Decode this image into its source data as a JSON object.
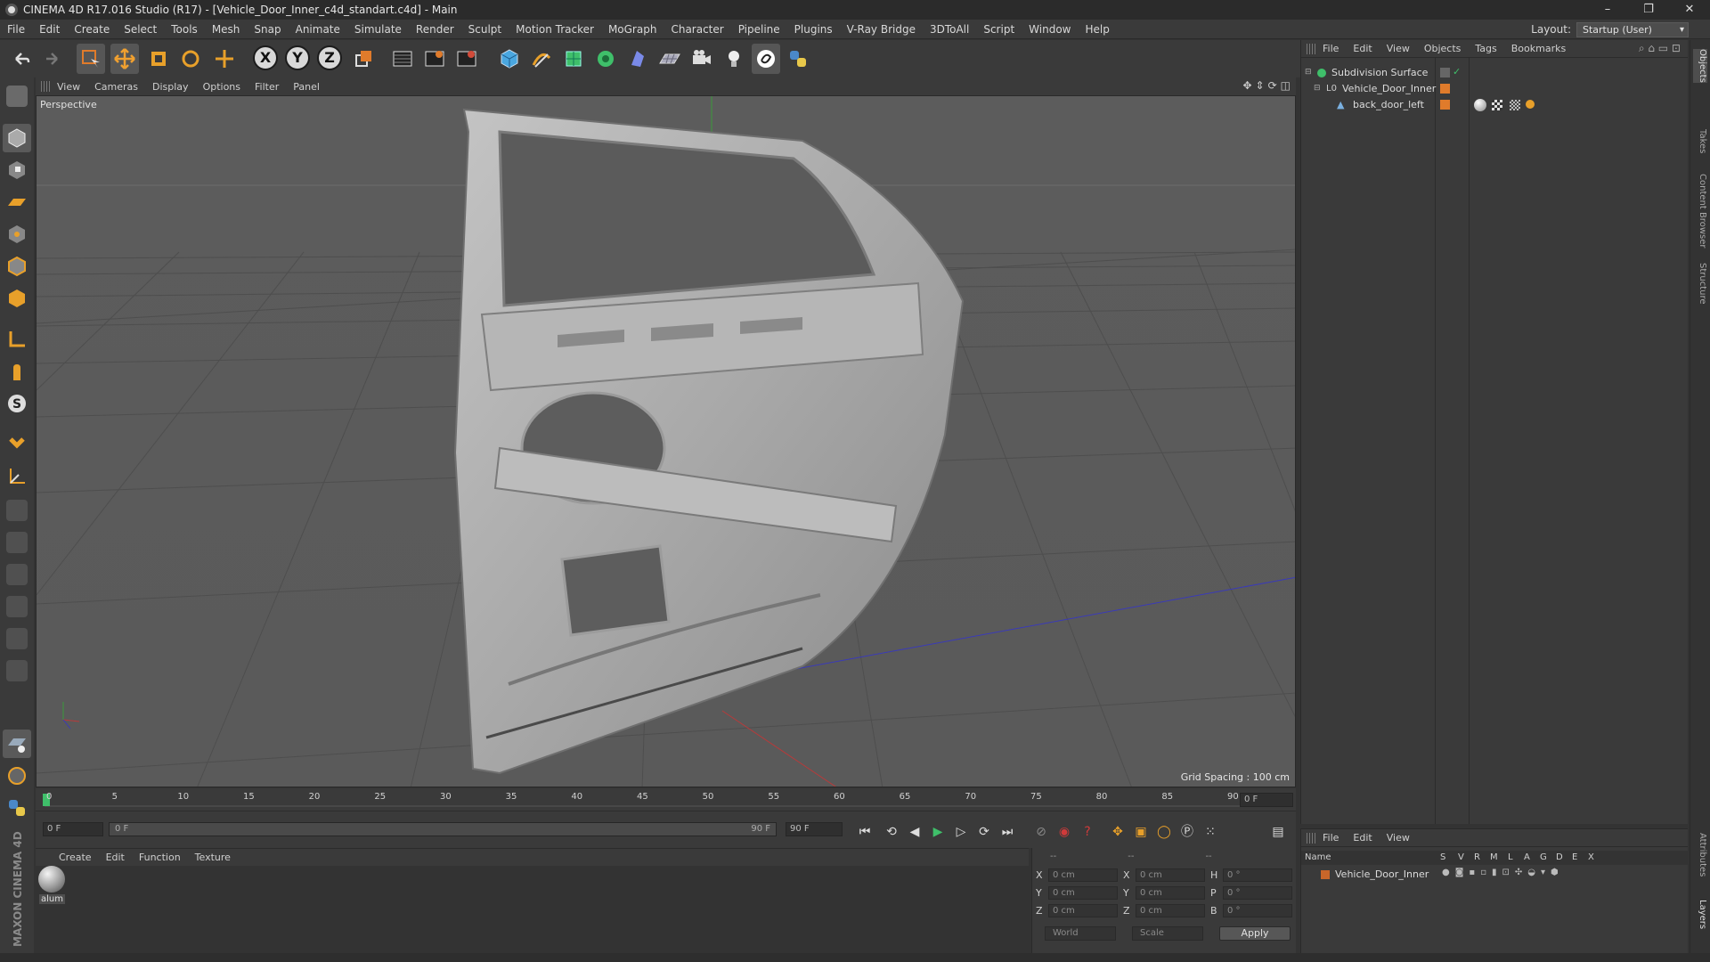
{
  "window": {
    "title": "CINEMA 4D R17.016 Studio (R17) - [Vehicle_Door_Inner_c4d_standart.c4d] - Main",
    "buttons": [
      "–",
      "❐",
      "✕"
    ]
  },
  "menubar": {
    "items": [
      "File",
      "Edit",
      "Create",
      "Select",
      "Tools",
      "Mesh",
      "Snap",
      "Animate",
      "Simulate",
      "Render",
      "Sculpt",
      "Motion Tracker",
      "MoGraph",
      "Character",
      "Pipeline",
      "Plugins",
      "V-Ray Bridge",
      "3DToAll",
      "Script",
      "Window",
      "Help"
    ],
    "layout_label": "Layout:",
    "layout_value": "Startup (User)"
  },
  "toolbar": {
    "axis": [
      "X",
      "Y",
      "Z"
    ],
    "icons": [
      "undo-icon",
      "redo-icon",
      "live-selection-icon",
      "move-icon",
      "scale-icon",
      "rotate-icon",
      "transform-icon",
      "x-axis-icon",
      "y-axis-icon",
      "z-axis-icon",
      "coordinate-system-icon",
      "render-view-icon",
      "render-picture-viewer-icon",
      "render-settings-icon",
      "cube-icon",
      "pen-icon",
      "subdivision-icon",
      "cloner-icon",
      "deformer-icon",
      "floor-icon",
      "camera-icon",
      "light-icon",
      "sketch-icon",
      "python-icon"
    ]
  },
  "viewport": {
    "menu": [
      "View",
      "Cameras",
      "Display",
      "Options",
      "Filter",
      "Panel"
    ],
    "label": "Perspective",
    "grid_spacing": "Grid Spacing : 100 cm",
    "nav": [
      "✥",
      "⇕",
      "⟳",
      "◫"
    ]
  },
  "timeline": {
    "ticks": [
      "0",
      "5",
      "10",
      "15",
      "20",
      "25",
      "30",
      "35",
      "40",
      "45",
      "50",
      "55",
      "60",
      "65",
      "70",
      "75",
      "80",
      "85",
      "90"
    ],
    "current_frame_right": "0 F",
    "start_field": "0 F",
    "range_start": "0 F",
    "range_end": "90 F",
    "end_field": "90 F"
  },
  "materials": {
    "menu": [
      "Create",
      "Edit",
      "Function",
      "Texture"
    ],
    "items": [
      {
        "name": "alum"
      }
    ]
  },
  "coordinates": {
    "header": [
      "--",
      "--",
      "--"
    ],
    "rows": [
      {
        "a": "X",
        "av": "0 cm",
        "b": "X",
        "bv": "0 cm",
        "c": "H",
        "cv": "0 °"
      },
      {
        "a": "Y",
        "av": "0 cm",
        "b": "Y",
        "bv": "0 cm",
        "c": "P",
        "cv": "0 °"
      },
      {
        "a": "Z",
        "av": "0 cm",
        "b": "Z",
        "bv": "0 cm",
        "c": "B",
        "cv": "0 °"
      }
    ],
    "world": "World",
    "scale": "Scale",
    "apply": "Apply"
  },
  "objects": {
    "menu": [
      "File",
      "Edit",
      "View",
      "Objects",
      "Tags",
      "Bookmarks"
    ],
    "tree": [
      {
        "name": "Subdivision Surface",
        "icon": "subdivision-icon"
      },
      {
        "name": "Vehicle_Door_Inner",
        "icon": "null-icon"
      },
      {
        "name": "back_door_left",
        "icon": "polygon-icon"
      }
    ]
  },
  "layers": {
    "menu": [
      "File",
      "Edit",
      "View"
    ],
    "columns": [
      "Name",
      "S",
      "V",
      "R",
      "M",
      "L",
      "A",
      "G",
      "D",
      "E",
      "X"
    ],
    "rows": [
      {
        "name": "Vehicle_Door_Inner"
      }
    ],
    "layer_color": "#c8662a"
  },
  "edge_tabs": [
    "Objects",
    "Takes",
    "Content Browser",
    "Structure",
    "Attributes",
    "Layers"
  ],
  "maxon_label": "MAXON CINEMA 4D",
  "colors": {
    "accent_orange": "#e07b2b",
    "viewport_bg": "#5a5a5a"
  }
}
